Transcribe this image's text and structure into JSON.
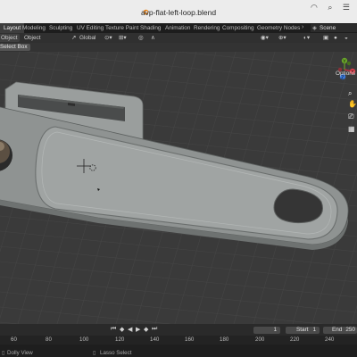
{
  "window": {
    "title": "avp-flat-left-loop.blend"
  },
  "workspace_tabs": [
    "Layout",
    "Modeling",
    "Sculpting",
    "UV Editing",
    "Texture Paint",
    "Shading",
    "Animation",
    "Rendering",
    "Compositing",
    "Geometry Nodes"
  ],
  "scene": {
    "label": "Scene"
  },
  "header": {
    "mode_label": "Object",
    "orientation_label": "Global"
  },
  "tool_header": {
    "select_label": "Select Box",
    "options_label": "Options"
  },
  "gizmo": {
    "x": "X",
    "y": "Y",
    "z": "Z"
  },
  "timeline": {
    "current_frame": "1",
    "start_label": "Start",
    "start_value": "1",
    "end_label": "End",
    "end_value": "250",
    "ruler_ticks": [
      "60",
      "80",
      "100",
      "120",
      "140",
      "160",
      "180",
      "200",
      "220",
      "240"
    ]
  },
  "status": {
    "left": "Dolly View",
    "mid": "Lasso Select"
  }
}
